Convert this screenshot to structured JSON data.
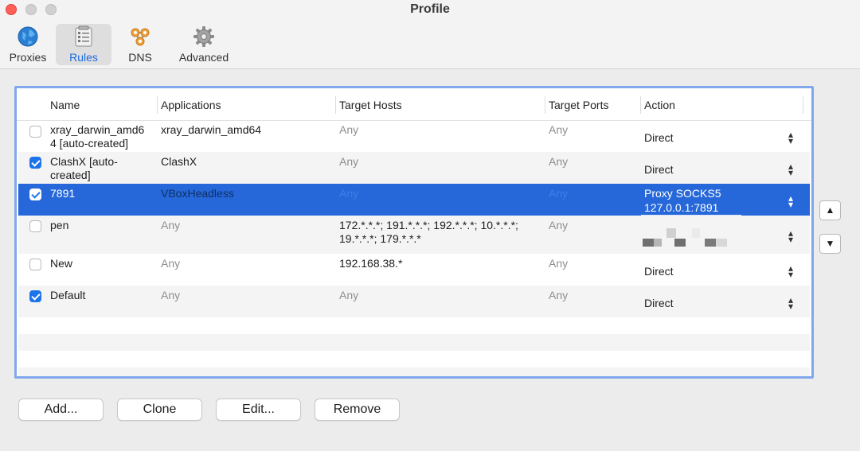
{
  "window": {
    "title": "Profile"
  },
  "toolbar": {
    "tabs": [
      {
        "label": "Proxies",
        "icon": "globe-icon"
      },
      {
        "label": "Rules",
        "icon": "rules-list-icon",
        "active": true
      },
      {
        "label": "DNS",
        "icon": "dns-network-icon"
      },
      {
        "label": "Advanced",
        "icon": "gear-icon"
      }
    ]
  },
  "table": {
    "columns": [
      "Name",
      "Applications",
      "Target Hosts",
      "Target Ports",
      "Action"
    ],
    "rows": [
      {
        "checked": false,
        "name_line1": "xray_darwin_amd6",
        "name_line2": "4 [auto-created]",
        "applications": "xray_darwin_amd64",
        "hosts": "Any",
        "hosts_line2": "",
        "ports": "Any",
        "action_line1": "Direct",
        "action_line2": ""
      },
      {
        "checked": true,
        "name_line1": "ClashX [auto-",
        "name_line2": "created]",
        "applications": "ClashX",
        "hosts": "Any",
        "hosts_line2": "",
        "ports": "Any",
        "action_line1": "Direct",
        "action_line2": ""
      },
      {
        "checked": true,
        "name_line1": "7891",
        "name_line2": "",
        "applications": "VBoxHeadless",
        "hosts": "Any",
        "hosts_line2": "",
        "ports": "Any",
        "action_line1": "Proxy SOCKS5",
        "action_line2": "127.0.0.1:7891"
      },
      {
        "checked": false,
        "name_line1": "pen",
        "name_line2": "",
        "applications": "Any",
        "hosts": "172.*.*.*; 191.*.*.*; 192.*.*.*; 10.*.*.*;",
        "hosts_line2": "19.*.*.*; 179.*.*.*",
        "ports": "Any",
        "action_line1": "",
        "action_line2": ""
      },
      {
        "checked": false,
        "name_line1": "New",
        "name_line2": "",
        "applications": "Any",
        "hosts": "192.168.38.*",
        "hosts_line2": "",
        "ports": "Any",
        "action_line1": "Direct",
        "action_line2": ""
      },
      {
        "checked": true,
        "name_line1": "Default",
        "name_line2": "",
        "applications": "Any",
        "hosts": "Any",
        "hosts_line2": "",
        "ports": "Any",
        "action_line1": "Direct",
        "action_line2": ""
      }
    ]
  },
  "side_buttons": {
    "up": "▲",
    "down": "▼"
  },
  "buttons": {
    "add": "Add...",
    "clone": "Clone",
    "edit": "Edit...",
    "remove": "Remove"
  },
  "colors": {
    "accent": "#1d73e8",
    "selection": "#2668d9",
    "close": "#ff5f57"
  }
}
